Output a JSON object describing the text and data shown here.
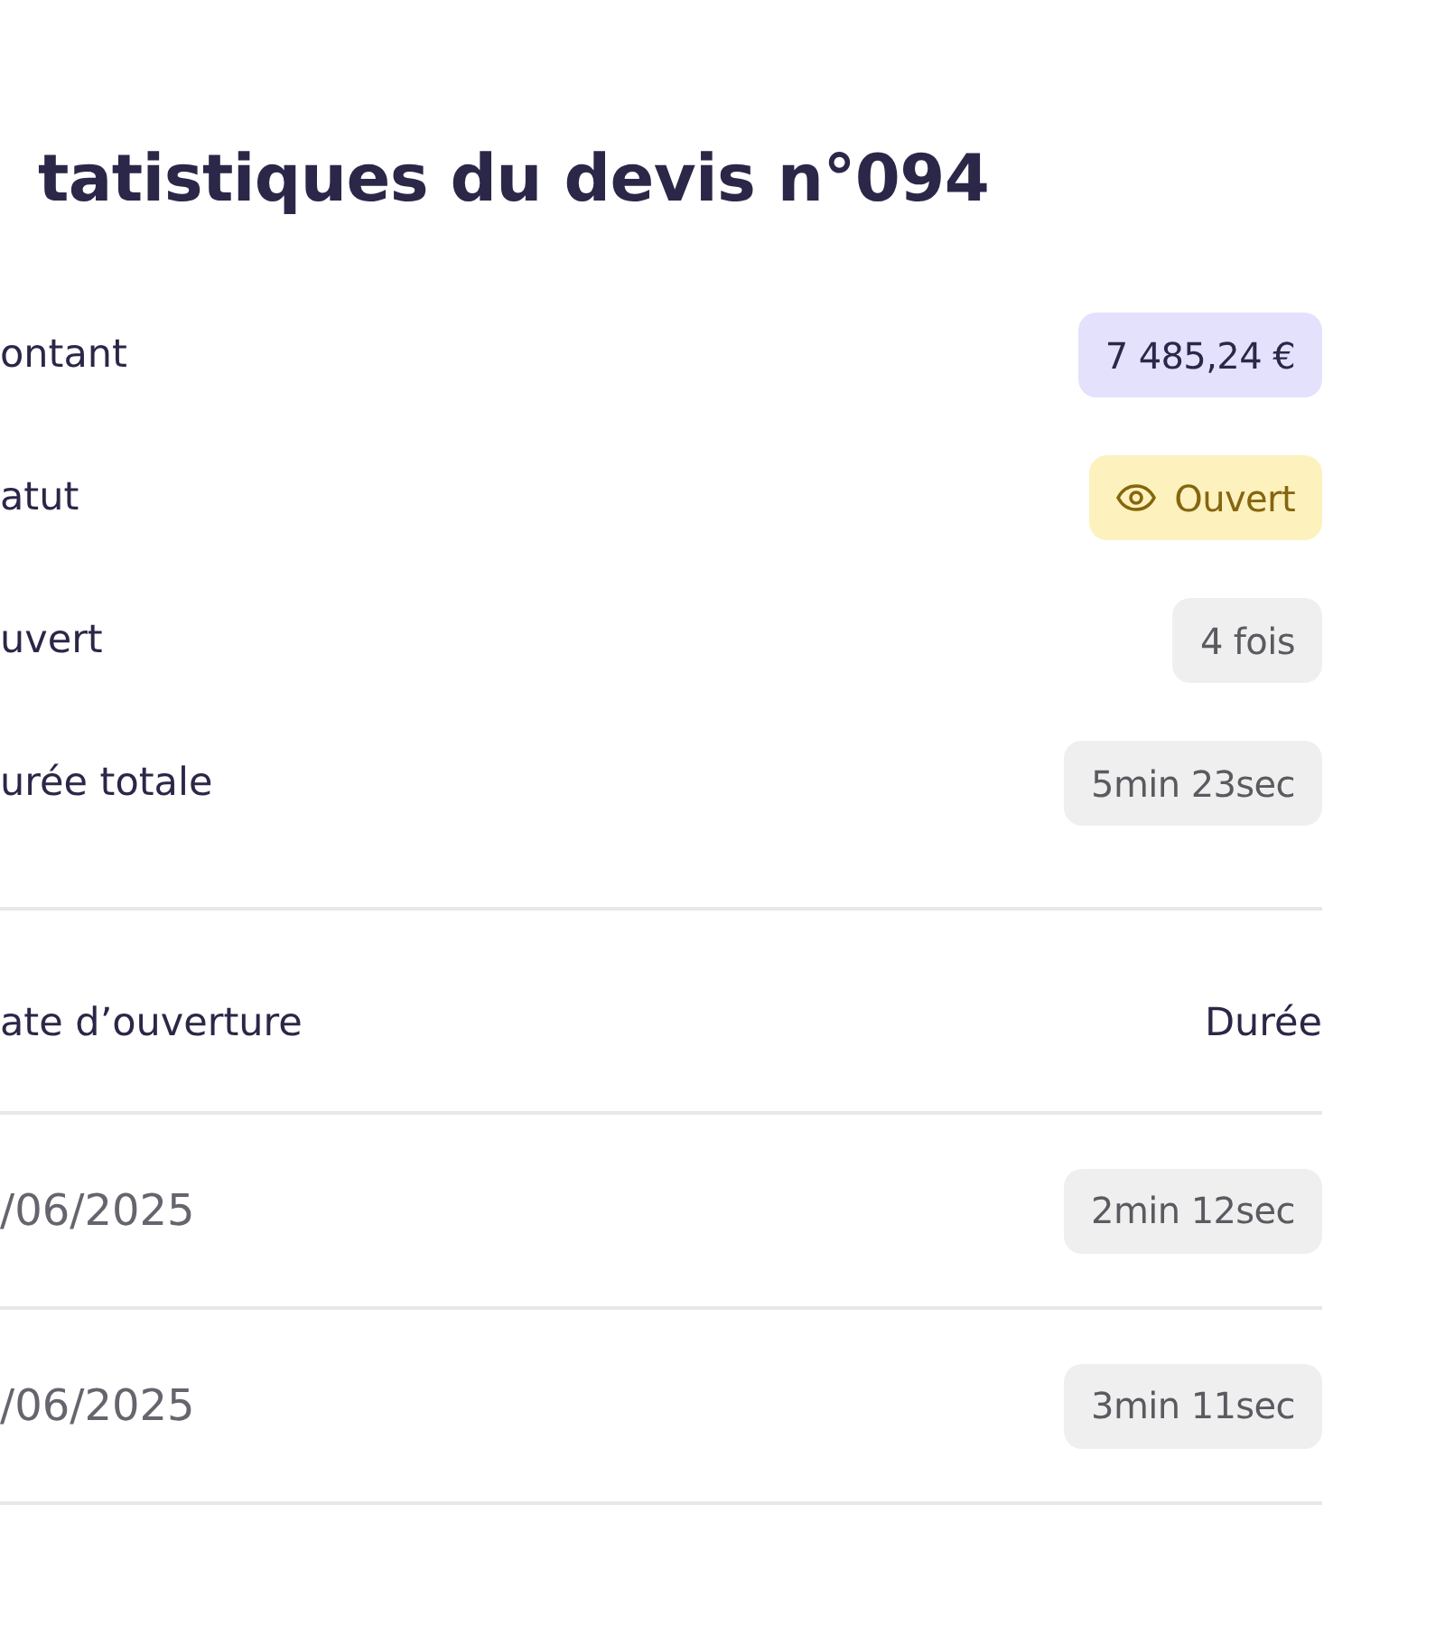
{
  "title": "tatistiques du devis n°094",
  "summary": [
    {
      "label": "ontant",
      "value": "7 485,24 €",
      "kind": "amount"
    },
    {
      "label": "atut",
      "value": "Ouvert",
      "kind": "status"
    },
    {
      "label": "uvert",
      "value": "4 fois",
      "kind": "count"
    },
    {
      "label": "urée totale",
      "value": "5min 23sec",
      "kind": "duration"
    }
  ],
  "table": {
    "columns": [
      "ate d’ouverture",
      "Durée"
    ],
    "rows": [
      {
        "date": "/06/2025",
        "duration": "2min 12sec"
      },
      {
        "date": "/06/2025",
        "duration": "3min 11sec"
      }
    ]
  }
}
